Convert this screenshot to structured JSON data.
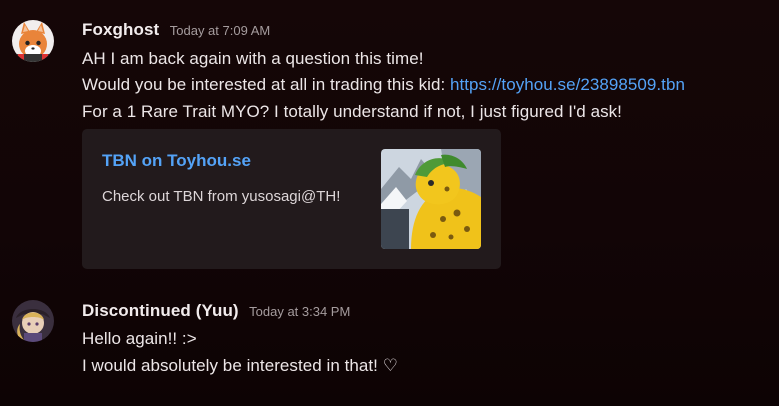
{
  "messages": [
    {
      "username": "Foxghost",
      "timestamp": "Today at 7:09 AM",
      "avatar_icon": "fox-avatar-icon",
      "lines": [
        {
          "text": "AH I am back again with a question this time!"
        },
        {
          "text": "Would you be interested at all in trading this kid: ",
          "link": "https://toyhou.se/23898509.tbn"
        },
        {
          "text": "For a 1 Rare Trait MYO? I totally understand if not, I just figured I'd ask!"
        }
      ],
      "embed": {
        "title": "TBN on Toyhou.se",
        "description": "Check out TBN from yusosagi@TH!",
        "thumbnail_icon": "character-thumbnail-icon"
      }
    },
    {
      "username": "Discontinued (Yuu)",
      "timestamp": "Today at 3:34 PM",
      "avatar_icon": "character-avatar-icon",
      "lines": [
        {
          "text": "Hello again!! :>"
        },
        {
          "text": "I would absolutely be interested in that! ♡"
        }
      ]
    }
  ],
  "colors": {
    "background": "#130506",
    "link": "#54a3f7",
    "embed_background": "#221a1c",
    "timestamp": "#a59c9e"
  }
}
